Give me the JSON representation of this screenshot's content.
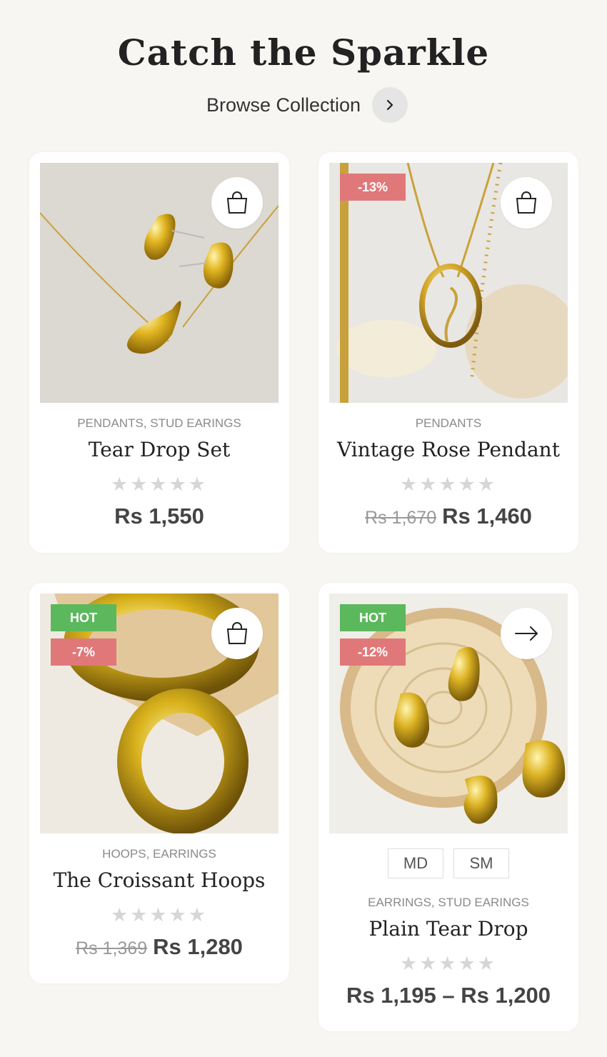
{
  "header": {
    "title": "Catch the Sparkle",
    "browse_label": "Browse Collection"
  },
  "products": [
    {
      "categories": "PENDANTS, STUD EARINGS",
      "name": "Tear Drop Set",
      "price": "Rs 1,550",
      "action_icon": "shopping-bag-icon"
    },
    {
      "badge_sale": "-13%",
      "categories": "PENDANTS",
      "name": "Vintage Rose Pendant",
      "old_price": "Rs 1,670",
      "price": "Rs 1,460",
      "action_icon": "shopping-bag-icon"
    },
    {
      "badge_hot": "HOT",
      "badge_sale": "-7%",
      "categories": "HOOPS, EARRINGS",
      "name": "The Croissant Hoops",
      "old_price": "Rs 1,369",
      "price": "Rs 1,280",
      "action_icon": "shopping-bag-icon"
    },
    {
      "badge_hot": "HOT",
      "badge_sale": "-12%",
      "sizes": [
        "MD",
        "SM"
      ],
      "categories": "EARRINGS, STUD EARINGS",
      "name": "Plain Tear Drop",
      "price": "Rs 1,195 – Rs 1,200",
      "action_icon": "arrow-right-icon"
    }
  ],
  "rating_stars": "★★★★★",
  "colors": {
    "sale_badge": "#e0787a",
    "hot_badge": "#5cb85c",
    "background": "#f7f6f3"
  }
}
